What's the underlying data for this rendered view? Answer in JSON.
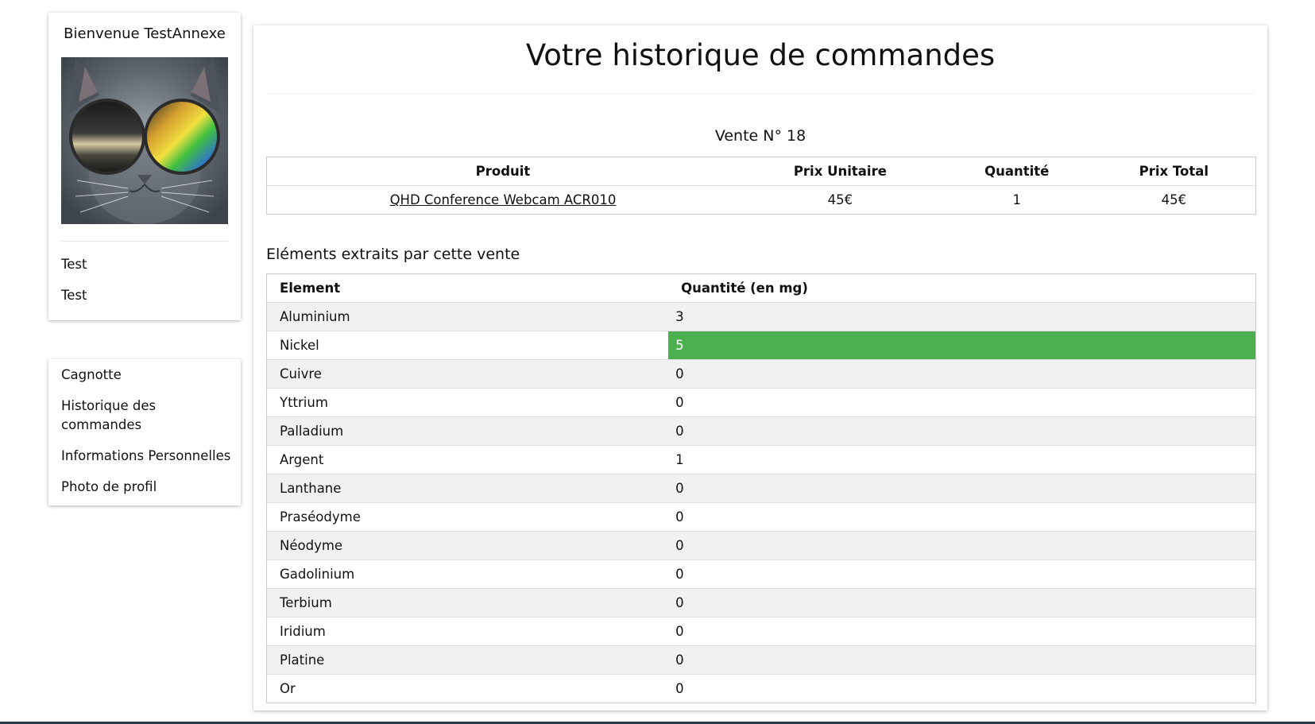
{
  "profile": {
    "welcome": "Bienvenue TestAnnexe",
    "avatar_alt": "avatar-cat-with-sunglasses",
    "links": [
      "Test",
      "Test"
    ]
  },
  "nav": {
    "items": [
      "Cagnotte",
      "Historique des commandes",
      "Informations Personnelles",
      "Photo de profil"
    ]
  },
  "main": {
    "title": "Votre historique de commandes",
    "sale_label": "Vente N° 18",
    "sale_table": {
      "headers": [
        "Produit",
        "Prix Unitaire",
        "Quantité",
        "Prix Total"
      ],
      "rows": [
        {
          "product": "QHD Conference Webcam ACR010",
          "unit_price": "45€",
          "quantity": "1",
          "total": "45€"
        }
      ]
    },
    "elements_title": "Eléments extraits par cette vente",
    "elements_table": {
      "headers": [
        "Element",
        "Quantité (en mg)"
      ],
      "rows": [
        {
          "element": "Aluminium",
          "qty": "3"
        },
        {
          "element": "Nickel",
          "qty": "5",
          "highlight": true
        },
        {
          "element": "Cuivre",
          "qty": "0"
        },
        {
          "element": "Yttrium",
          "qty": "0"
        },
        {
          "element": "Palladium",
          "qty": "0"
        },
        {
          "element": "Argent",
          "qty": "1"
        },
        {
          "element": "Lanthane",
          "qty": "0"
        },
        {
          "element": "Praséodyme",
          "qty": "0"
        },
        {
          "element": "Néodyme",
          "qty": "0"
        },
        {
          "element": "Gadolinium",
          "qty": "0"
        },
        {
          "element": "Terbium",
          "qty": "0"
        },
        {
          "element": "Iridium",
          "qty": "0"
        },
        {
          "element": "Platine",
          "qty": "0"
        },
        {
          "element": "Or",
          "qty": "0"
        }
      ]
    }
  },
  "colors": {
    "highlight": "#4caf50",
    "row_alt": "#f1f1f1",
    "border": "#cccccc"
  }
}
